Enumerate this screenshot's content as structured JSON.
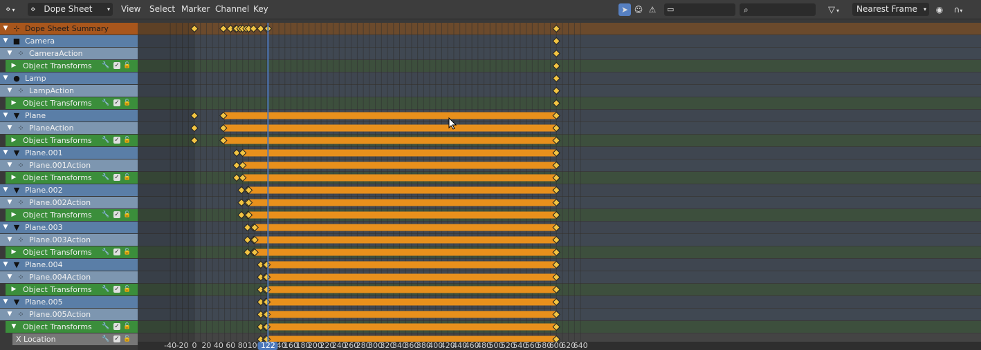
{
  "header": {
    "editor_label": "Dope Sheet",
    "menus": [
      "View",
      "Select",
      "Marker",
      "Channel",
      "Key"
    ],
    "snap_mode": "Nearest Frame"
  },
  "colors": {
    "summary": "#a8561c",
    "object": "#5a7ea7",
    "action": "#7d96b0",
    "group": "#3b8e3b",
    "channel": "#777777",
    "keyframe": "#f2c442",
    "hold_bar": "#e8901c",
    "playhead": "#4c78ba"
  },
  "current_frame": "122",
  "current_frame_value": 122,
  "axis": {
    "min": -40,
    "max": 640,
    "ticks": [
      "-40",
      "-20",
      "0",
      "20",
      "40",
      "60",
      "80",
      "100",
      "120",
      "140",
      "160",
      "180",
      "200",
      "220",
      "240",
      "260",
      "280",
      "300",
      "320",
      "340",
      "360",
      "380",
      "400",
      "420",
      "440",
      "460",
      "480",
      "500",
      "520",
      "540",
      "560",
      "580",
      "600",
      "620",
      "640"
    ]
  },
  "channels": [
    {
      "label": "Dope Sheet Summary",
      "kind": "summary",
      "icon": "dopesheet-icon",
      "indent": 0,
      "expanded": true,
      "keys": [
        0,
        48,
        60,
        68,
        70,
        76,
        80,
        86,
        90,
        98,
        110,
        120,
        122,
        600
      ],
      "holds": []
    },
    {
      "label": "Camera",
      "kind": "object",
      "icon": "camera-icon",
      "indent": 0,
      "expanded": true,
      "keys": [
        600
      ],
      "holds": []
    },
    {
      "label": "CameraAction",
      "kind": "action",
      "icon": "action-icon",
      "indent": 1,
      "expanded": true,
      "keys": [
        600
      ],
      "holds": []
    },
    {
      "label": "Object Transforms",
      "kind": "group",
      "icon": "",
      "indent": 1,
      "expanded": false,
      "keys": [
        600
      ],
      "holds": []
    },
    {
      "label": "Lamp",
      "kind": "object",
      "icon": "lamp-icon",
      "indent": 0,
      "expanded": true,
      "keys": [
        600
      ],
      "holds": []
    },
    {
      "label": "LampAction",
      "kind": "action",
      "icon": "action-icon",
      "indent": 1,
      "expanded": true,
      "keys": [
        600
      ],
      "holds": []
    },
    {
      "label": "Object Transforms",
      "kind": "group",
      "icon": "",
      "indent": 1,
      "expanded": false,
      "keys": [
        600
      ],
      "holds": []
    },
    {
      "label": "Plane",
      "kind": "object",
      "icon": "mesh-icon",
      "indent": 0,
      "expanded": true,
      "keys": [
        0,
        48,
        600
      ],
      "holds": [
        [
          48,
          600
        ]
      ]
    },
    {
      "label": "PlaneAction",
      "kind": "action",
      "icon": "action-icon",
      "indent": 1,
      "expanded": true,
      "keys": [
        0,
        48,
        600
      ],
      "holds": [
        [
          48,
          600
        ]
      ]
    },
    {
      "label": "Object Transforms",
      "kind": "group",
      "icon": "",
      "indent": 1,
      "expanded": false,
      "keys": [
        0,
        48,
        600
      ],
      "holds": [
        [
          48,
          600
        ]
      ]
    },
    {
      "label": "Plane.001",
      "kind": "object",
      "icon": "mesh-icon",
      "indent": 0,
      "expanded": true,
      "keys": [
        70,
        80,
        600
      ],
      "holds": [
        [
          80,
          600
        ]
      ]
    },
    {
      "label": "Plane.001Action",
      "kind": "action",
      "icon": "action-icon",
      "indent": 1,
      "expanded": true,
      "keys": [
        70,
        80,
        600
      ],
      "holds": [
        [
          80,
          600
        ]
      ]
    },
    {
      "label": "Object Transforms",
      "kind": "group",
      "icon": "",
      "indent": 1,
      "expanded": false,
      "keys": [
        70,
        80,
        600
      ],
      "holds": [
        [
          80,
          600
        ]
      ]
    },
    {
      "label": "Plane.002",
      "kind": "object",
      "icon": "mesh-icon",
      "indent": 0,
      "expanded": true,
      "keys": [
        78,
        88,
        90,
        600
      ],
      "holds": [
        [
          90,
          600
        ]
      ]
    },
    {
      "label": "Plane.002Action",
      "kind": "action",
      "icon": "action-icon",
      "indent": 1,
      "expanded": true,
      "keys": [
        78,
        88,
        90,
        600
      ],
      "holds": [
        [
          90,
          600
        ]
      ]
    },
    {
      "label": "Object Transforms",
      "kind": "group",
      "icon": "",
      "indent": 1,
      "expanded": false,
      "keys": [
        78,
        88,
        90,
        600
      ],
      "holds": [
        [
          90,
          600
        ]
      ]
    },
    {
      "label": "Plane.003",
      "kind": "object",
      "icon": "mesh-icon",
      "indent": 0,
      "expanded": true,
      "keys": [
        88,
        98,
        100,
        600
      ],
      "holds": [
        [
          100,
          600
        ]
      ]
    },
    {
      "label": "Plane.003Action",
      "kind": "action",
      "icon": "action-icon",
      "indent": 1,
      "expanded": true,
      "keys": [
        88,
        98,
        100,
        600
      ],
      "holds": [
        [
          100,
          600
        ]
      ]
    },
    {
      "label": "Object Transforms",
      "kind": "group",
      "icon": "",
      "indent": 1,
      "expanded": false,
      "keys": [
        88,
        98,
        100,
        600
      ],
      "holds": [
        [
          100,
          600
        ]
      ]
    },
    {
      "label": "Plane.004",
      "kind": "object",
      "icon": "mesh-icon",
      "indent": 0,
      "expanded": true,
      "keys": [
        110,
        118,
        120,
        600
      ],
      "holds": [
        [
          120,
          600
        ]
      ]
    },
    {
      "label": "Plane.004Action",
      "kind": "action",
      "icon": "action-icon",
      "indent": 1,
      "expanded": true,
      "keys": [
        110,
        118,
        120,
        600
      ],
      "holds": [
        [
          120,
          600
        ]
      ]
    },
    {
      "label": "Object Transforms",
      "kind": "group",
      "icon": "",
      "indent": 1,
      "expanded": false,
      "keys": [
        110,
        118,
        120,
        600
      ],
      "holds": [
        [
          120,
          600
        ]
      ]
    },
    {
      "label": "Plane.005",
      "kind": "object",
      "icon": "mesh-icon",
      "indent": 0,
      "expanded": true,
      "keys": [
        110,
        118,
        120,
        600
      ],
      "holds": [
        [
          120,
          600
        ]
      ]
    },
    {
      "label": "Plane.005Action",
      "kind": "action",
      "icon": "action-icon",
      "indent": 1,
      "expanded": true,
      "keys": [
        110,
        118,
        120,
        600
      ],
      "holds": [
        [
          120,
          600
        ]
      ]
    },
    {
      "label": "Object Transforms",
      "kind": "group",
      "icon": "",
      "indent": 1,
      "expanded": true,
      "keys": [
        110,
        118,
        120,
        600
      ],
      "holds": [
        [
          120,
          600
        ]
      ]
    },
    {
      "label": "X Location",
      "kind": "channel",
      "icon": "",
      "indent": 2,
      "expanded": false,
      "keys": [
        110,
        118,
        120,
        600
      ],
      "holds": [
        [
          120,
          600
        ]
      ]
    }
  ]
}
